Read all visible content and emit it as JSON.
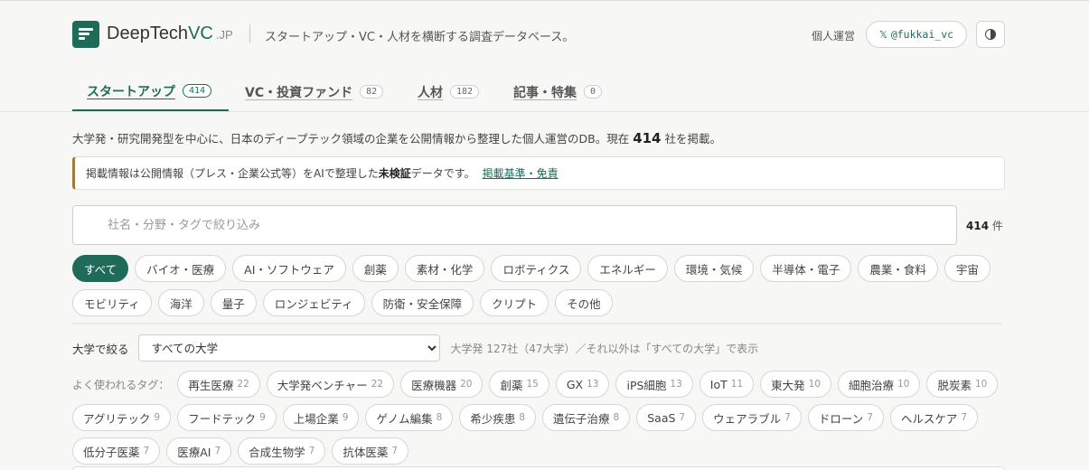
{
  "header": {
    "brand_main": "DeepTech",
    "brand_accent": "VC",
    "brand_suffix": ".JP",
    "tagline": "スタートアップ・VC・人材を横断する調査データベース。",
    "operator_label": "個人運営",
    "x_icon": "x-logo-icon",
    "x_handle": "@fukkai_vc",
    "theme_icon": "theme-toggle-icon"
  },
  "tabs": [
    {
      "label": "スタートアップ",
      "count": "414",
      "active": true
    },
    {
      "label": "VC・投資ファンド",
      "count": "82"
    },
    {
      "label": "人材",
      "count": "182"
    },
    {
      "label": "記事・特集",
      "count": "0"
    }
  ],
  "intro": {
    "before": "大学発・研究開発型を中心に、日本のディープテック領域の企業を公開情報から整理した個人運営のDB。現在",
    "number": "414",
    "after": "社を掲載。"
  },
  "notice": {
    "before": "掲載情報は公開情報（プレス・企業公式等）をAIで整理した",
    "bold": "未検証",
    "after": "データです。",
    "link": "掲載基準・免責"
  },
  "search": {
    "placeholder": "社名・分野・タグで絞り込み",
    "value": "",
    "count_number": "414",
    "count_unit": "件"
  },
  "categories": [
    "すべて",
    "バイオ・医療",
    "AI・ソフトウェア",
    "創薬",
    "素材・化学",
    "ロボティクス",
    "エネルギー",
    "環境・気候",
    "半導体・電子",
    "農業・食料",
    "宇宙",
    "モビリティ",
    "海洋",
    "量子",
    "ロンジェビティ",
    "防衛・安全保障",
    "クリプト",
    "その他"
  ],
  "university": {
    "label": "大学で絞る",
    "selected": "すべての大学",
    "note": "大学発 127社（47大学）／それ以外は「すべての大学」で表示"
  },
  "tags": {
    "label": "よく使われるタグ：",
    "items": [
      {
        "name": "再生医療",
        "n": "22"
      },
      {
        "name": "大学発ベンチャー",
        "n": "22"
      },
      {
        "name": "医療機器",
        "n": "20"
      },
      {
        "name": "創薬",
        "n": "15"
      },
      {
        "name": "GX",
        "n": "13"
      },
      {
        "name": "iPS細胞",
        "n": "13"
      },
      {
        "name": "IoT",
        "n": "11"
      },
      {
        "name": "東大発",
        "n": "10"
      },
      {
        "name": "細胞治療",
        "n": "10"
      },
      {
        "name": "脱炭素",
        "n": "10"
      },
      {
        "name": "アグリテック",
        "n": "9"
      },
      {
        "name": "フードテック",
        "n": "9"
      },
      {
        "name": "上場企業",
        "n": "9"
      },
      {
        "name": "ゲノム編集",
        "n": "8"
      },
      {
        "name": "希少疾患",
        "n": "8"
      },
      {
        "name": "遺伝子治療",
        "n": "8"
      },
      {
        "name": "SaaS",
        "n": "7"
      },
      {
        "name": "ウェアラブル",
        "n": "7"
      },
      {
        "name": "ドローン",
        "n": "7"
      },
      {
        "name": "ヘルスケア",
        "n": "7"
      },
      {
        "name": "低分子医薬",
        "n": "7"
      },
      {
        "name": "医療AI",
        "n": "7"
      },
      {
        "name": "合成生物学",
        "n": "7"
      },
      {
        "name": "抗体医薬",
        "n": "7"
      }
    ]
  },
  "colors": {
    "accent": "#1e6b5a",
    "notice_border": "#a07a3c"
  }
}
